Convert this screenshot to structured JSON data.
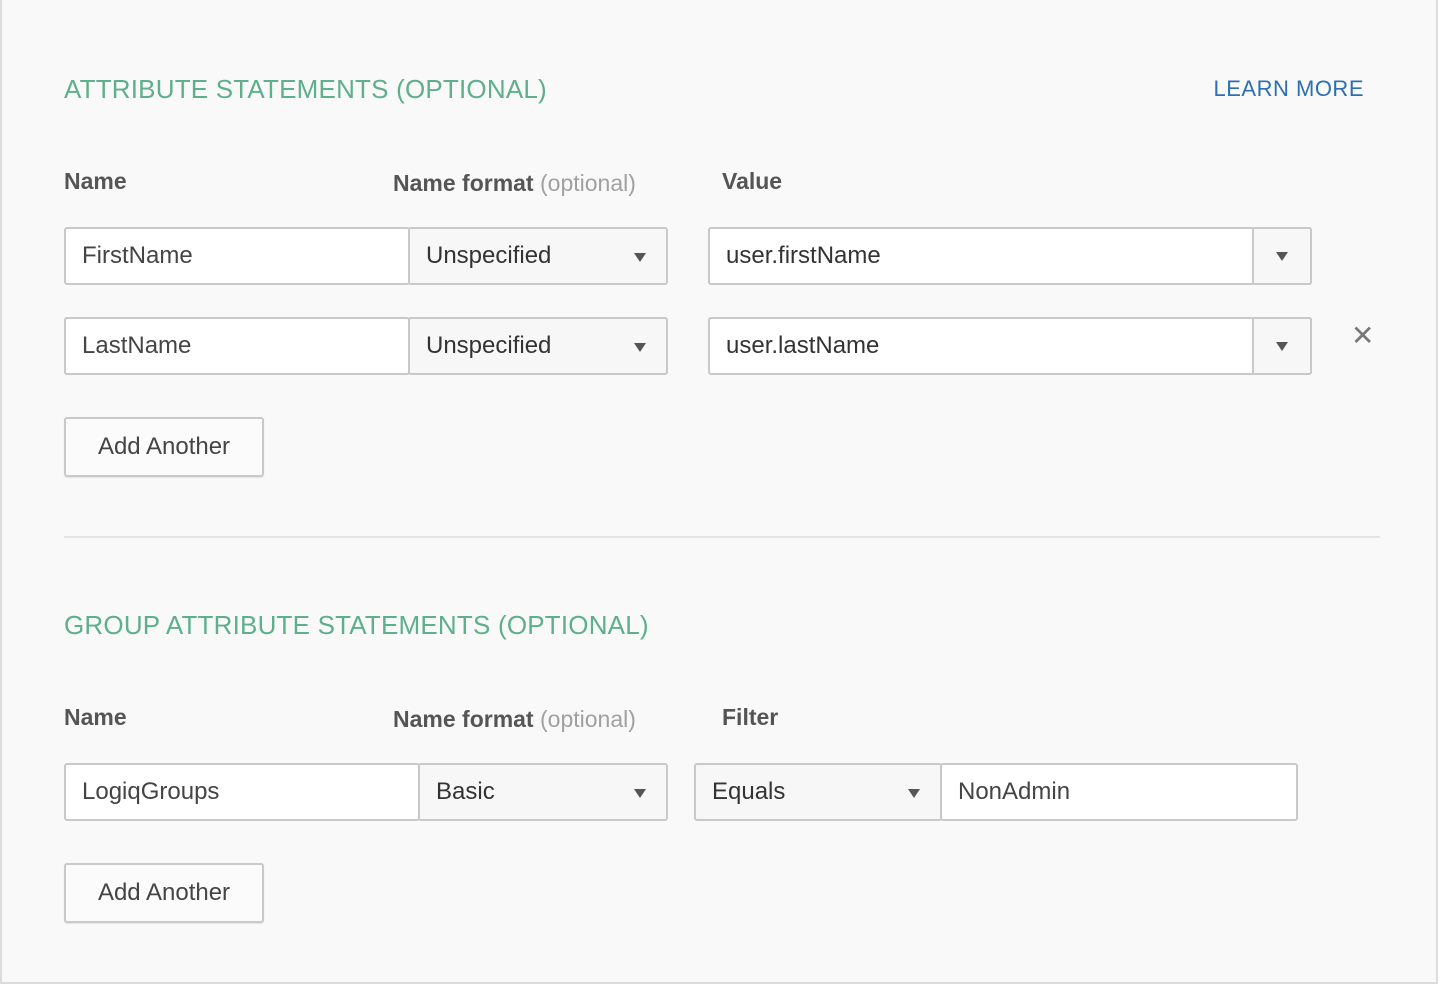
{
  "attribute_statements": {
    "title": "ATTRIBUTE STATEMENTS (OPTIONAL)",
    "learn_more": "LEARN MORE",
    "columns": {
      "name": "Name",
      "name_format": "Name format",
      "name_format_optional": "(optional)",
      "value": "Value"
    },
    "rows": [
      {
        "name": "FirstName",
        "name_format": "Unspecified",
        "value": "user.firstName"
      },
      {
        "name": "LastName",
        "name_format": "Unspecified",
        "value": "user.lastName"
      }
    ],
    "add_another": "Add Another"
  },
  "group_attribute_statements": {
    "title": "GROUP ATTRIBUTE STATEMENTS (OPTIONAL)",
    "columns": {
      "name": "Name",
      "name_format": "Name format",
      "name_format_optional": "(optional)",
      "filter": "Filter"
    },
    "rows": [
      {
        "name": "LogiqGroups",
        "name_format": "Basic",
        "filter_type": "Equals",
        "filter_value": "NonAdmin"
      }
    ],
    "add_another": "Add Another"
  },
  "icons": {
    "remove": "close-icon",
    "dropdown": "chevron-down-icon"
  },
  "colors": {
    "section_title": "#5eaf8c",
    "link": "#2e6fb4",
    "panel_bg": "#f9f9f9"
  }
}
